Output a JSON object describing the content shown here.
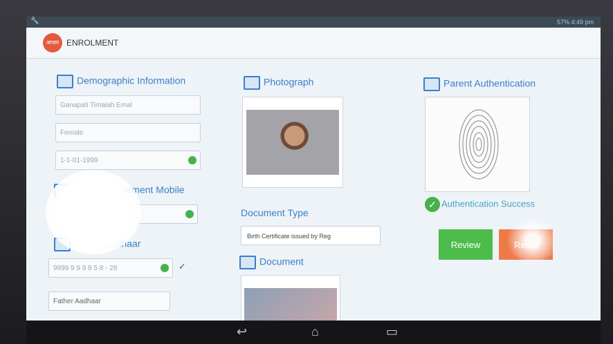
{
  "status": {
    "right_text": "57% 4:49 pm"
  },
  "app": {
    "title": "ENROLMENT",
    "logo_text": "आधार"
  },
  "demographic": {
    "heading": "Demographic Information",
    "name_value": "Ganapati Timaiah Emal",
    "gender_value": "Female",
    "dob_value": "1-1-01-1999"
  },
  "mobile": {
    "heading": "Acknowledgement Mobile"
  },
  "father_aadhaar_section": {
    "heading": "Father Aadhaar",
    "value": "9999 9 9 9 8 5 8 - 28",
    "placeholder": "Father Aadhaar"
  },
  "photograph": {
    "heading": "Photograph"
  },
  "document_type": {
    "label": "Document Type",
    "selected": "Birth Certificate issued by Reg"
  },
  "document": {
    "heading": "Document"
  },
  "parent_auth": {
    "heading": "Parent Authentication",
    "status": "Authentication Success"
  },
  "buttons": {
    "review": "Review",
    "reset": "Reset"
  },
  "nav": {
    "back": "↩",
    "home": "⌂",
    "recents": "▭"
  },
  "colors": {
    "accent": "#3a7fc8",
    "success": "#49b04e",
    "review": "#4cbc4a",
    "reset": "#ee7a48"
  }
}
